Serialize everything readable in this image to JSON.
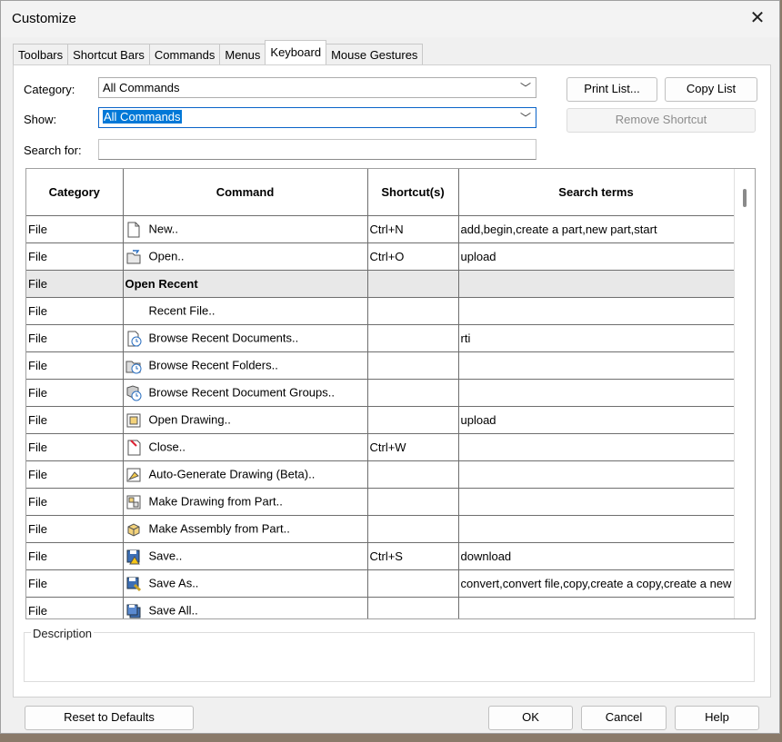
{
  "window": {
    "title": "Customize"
  },
  "tabs": [
    "Toolbars",
    "Shortcut Bars",
    "Commands",
    "Menus",
    "Keyboard",
    "Mouse Gestures"
  ],
  "active_tab": "Keyboard",
  "form": {
    "category_label": "Category:",
    "category_value": "All Commands",
    "show_label": "Show:",
    "show_value": "All Commands",
    "search_label": "Search for:",
    "search_value": ""
  },
  "buttons": {
    "print_list": "Print List...",
    "copy_list": "Copy List",
    "remove_shortcut": "Remove Shortcut",
    "reset": "Reset to Defaults",
    "ok": "OK",
    "cancel": "Cancel",
    "help": "Help"
  },
  "table": {
    "headers": [
      "Category",
      "Command",
      "Shortcut(s)",
      "Search terms"
    ],
    "rows": [
      {
        "category": "File",
        "command": "New..",
        "shortcut": "Ctrl+N",
        "search": "add,begin,create a part,new part,start",
        "icon": "new-document-icon",
        "indent": false,
        "bold": false
      },
      {
        "category": "File",
        "command": "Open..",
        "shortcut": "Ctrl+O",
        "search": "upload",
        "icon": "open-file-icon",
        "indent": false,
        "bold": false
      },
      {
        "category": "File",
        "command": "Open Recent",
        "shortcut": "",
        "search": "",
        "icon": "",
        "indent": false,
        "bold": true
      },
      {
        "category": "File",
        "command": "Recent File..",
        "shortcut": "",
        "search": "",
        "icon": "",
        "indent": true,
        "bold": false
      },
      {
        "category": "File",
        "command": "Browse Recent Documents..",
        "shortcut": "",
        "search": "rti",
        "icon": "recent-documents-icon",
        "indent": false,
        "bold": false
      },
      {
        "category": "File",
        "command": "Browse Recent Folders..",
        "shortcut": "",
        "search": "",
        "icon": "recent-folders-icon",
        "indent": false,
        "bold": false
      },
      {
        "category": "File",
        "command": "Browse Recent Document Groups..",
        "shortcut": "",
        "search": "",
        "icon": "recent-groups-icon",
        "indent": false,
        "bold": false
      },
      {
        "category": "File",
        "command": "Open Drawing..",
        "shortcut": "",
        "search": "upload",
        "icon": "open-drawing-icon",
        "indent": false,
        "bold": false
      },
      {
        "category": "File",
        "command": "Close..",
        "shortcut": "Ctrl+W",
        "search": "",
        "icon": "close-document-icon",
        "indent": false,
        "bold": false
      },
      {
        "category": "File",
        "command": "Auto-Generate Drawing (Beta)..",
        "shortcut": "",
        "search": "",
        "icon": "auto-drawing-icon",
        "indent": false,
        "bold": false
      },
      {
        "category": "File",
        "command": "Make Drawing from Part..",
        "shortcut": "",
        "search": "",
        "icon": "make-drawing-icon",
        "indent": false,
        "bold": false
      },
      {
        "category": "File",
        "command": "Make Assembly from Part..",
        "shortcut": "",
        "search": "",
        "icon": "make-assembly-icon",
        "indent": false,
        "bold": false
      },
      {
        "category": "File",
        "command": "Save..",
        "shortcut": "Ctrl+S",
        "search": "download",
        "icon": "save-icon",
        "indent": false,
        "bold": false
      },
      {
        "category": "File",
        "command": "Save As..",
        "shortcut": "",
        "search": "convert,convert file,copy,create a copy,create a new",
        "icon": "save-as-icon",
        "indent": false,
        "bold": false
      },
      {
        "category": "File",
        "command": "Save All..",
        "shortcut": "",
        "search": "",
        "icon": "save-all-icon",
        "indent": false,
        "bold": false
      }
    ]
  },
  "description": {
    "label": "Description"
  }
}
